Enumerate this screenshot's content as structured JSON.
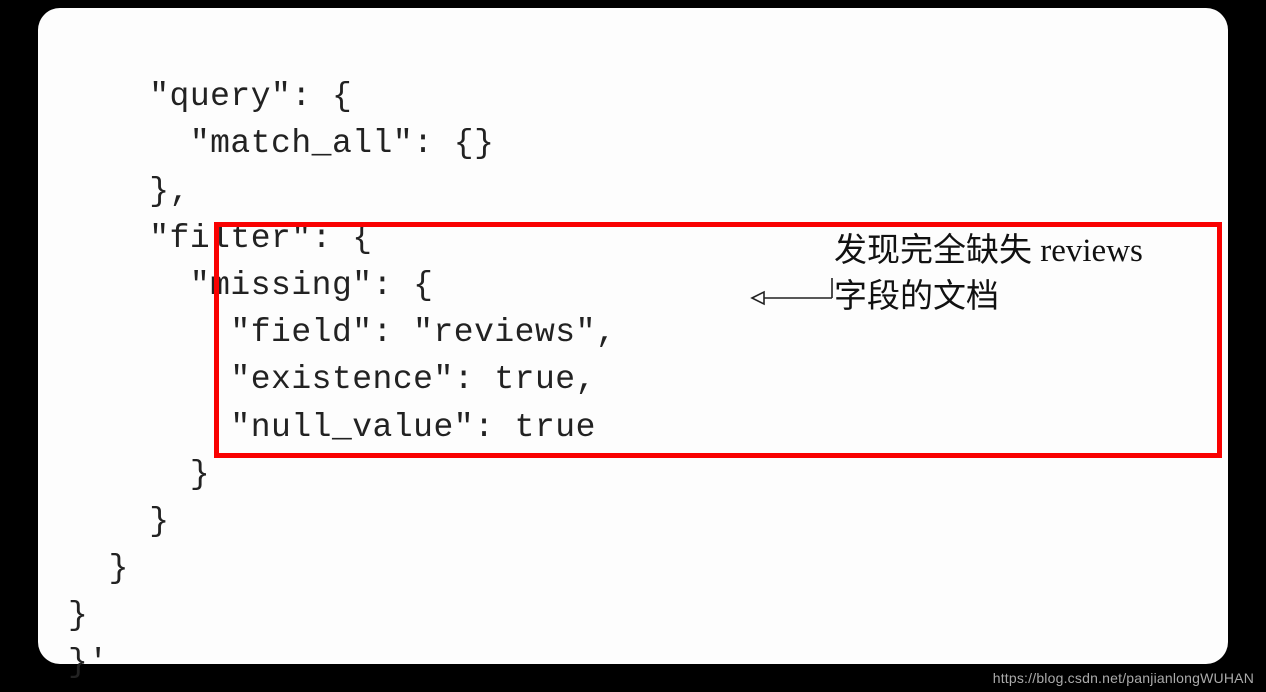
{
  "code": {
    "line1": "    \"query\": {",
    "line2": "      \"match_all\": {}",
    "line3": "    },",
    "line4": "    \"filter\": {",
    "line5": "      \"missing\": {",
    "line6": "        \"field\": \"reviews\",",
    "line7": "        \"existence\": true,",
    "line8": "        \"null_value\": true",
    "line9": "      }",
    "line10": "    }",
    "line11": "  }",
    "line12": "}",
    "line13": "}'"
  },
  "annotation": {
    "line1": "发现完全缺失 reviews",
    "line2": "字段的文档"
  },
  "watermark": "https://blog.csdn.net/panjianlongWUHAN"
}
